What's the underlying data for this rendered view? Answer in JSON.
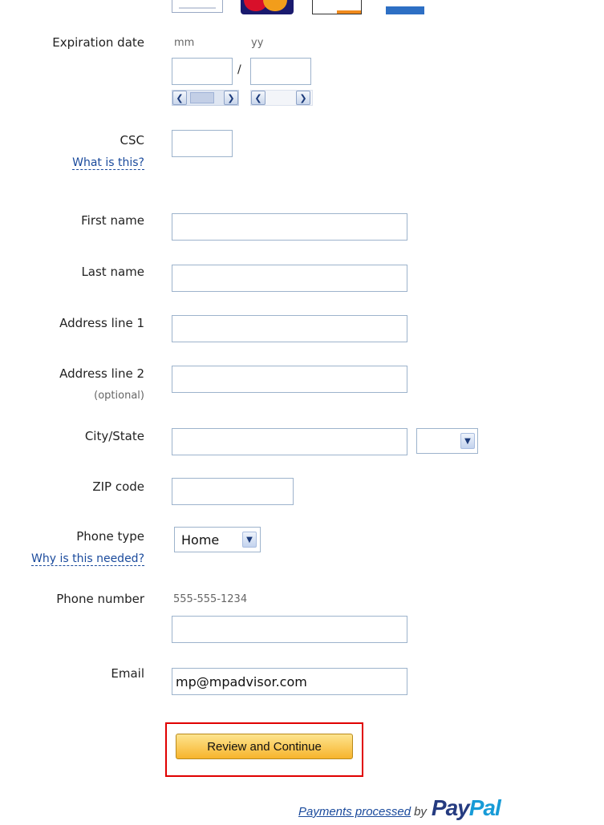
{
  "form": {
    "expiration": {
      "label": "Expiration date",
      "mm_hint": "mm",
      "yy_hint": "yy",
      "separator": "/"
    },
    "csc": {
      "label": "CSC",
      "help_link": "What is this?"
    },
    "first_name": {
      "label": "First name",
      "value": ""
    },
    "last_name": {
      "label": "Last name",
      "value": ""
    },
    "address1": {
      "label": "Address line 1",
      "value": ""
    },
    "address2": {
      "label": "Address line 2",
      "note": "(optional)",
      "value": ""
    },
    "city_state": {
      "label": "City/State",
      "value": ""
    },
    "zip": {
      "label": "ZIP code",
      "value": ""
    },
    "phone_type": {
      "label": "Phone type",
      "help_link": "Why is this needed?",
      "selected": "Home"
    },
    "phone_number": {
      "label": "Phone number",
      "example": "555-555-1234",
      "value": ""
    },
    "email": {
      "label": "Email",
      "value": "mp@mpadvisor.com"
    },
    "submit_label": "Review and Continue"
  },
  "footer": {
    "processed_link": "Payments processed",
    "by_text": "by",
    "brand_pay": "Pay",
    "brand_pal": "Pal"
  },
  "colors": {
    "link": "#1a4a9c",
    "button_top": "#fde48f",
    "button_bottom": "#f7b42c",
    "highlight_border": "#e00000",
    "paypal_dark": "#253b80",
    "paypal_light": "#179bd7"
  },
  "icons": [
    "visa-card-icon",
    "mastercard-icon",
    "discover-card-icon",
    "amex-card-icon",
    "chevron-left-icon",
    "chevron-right-icon",
    "chevron-down-icon"
  ]
}
